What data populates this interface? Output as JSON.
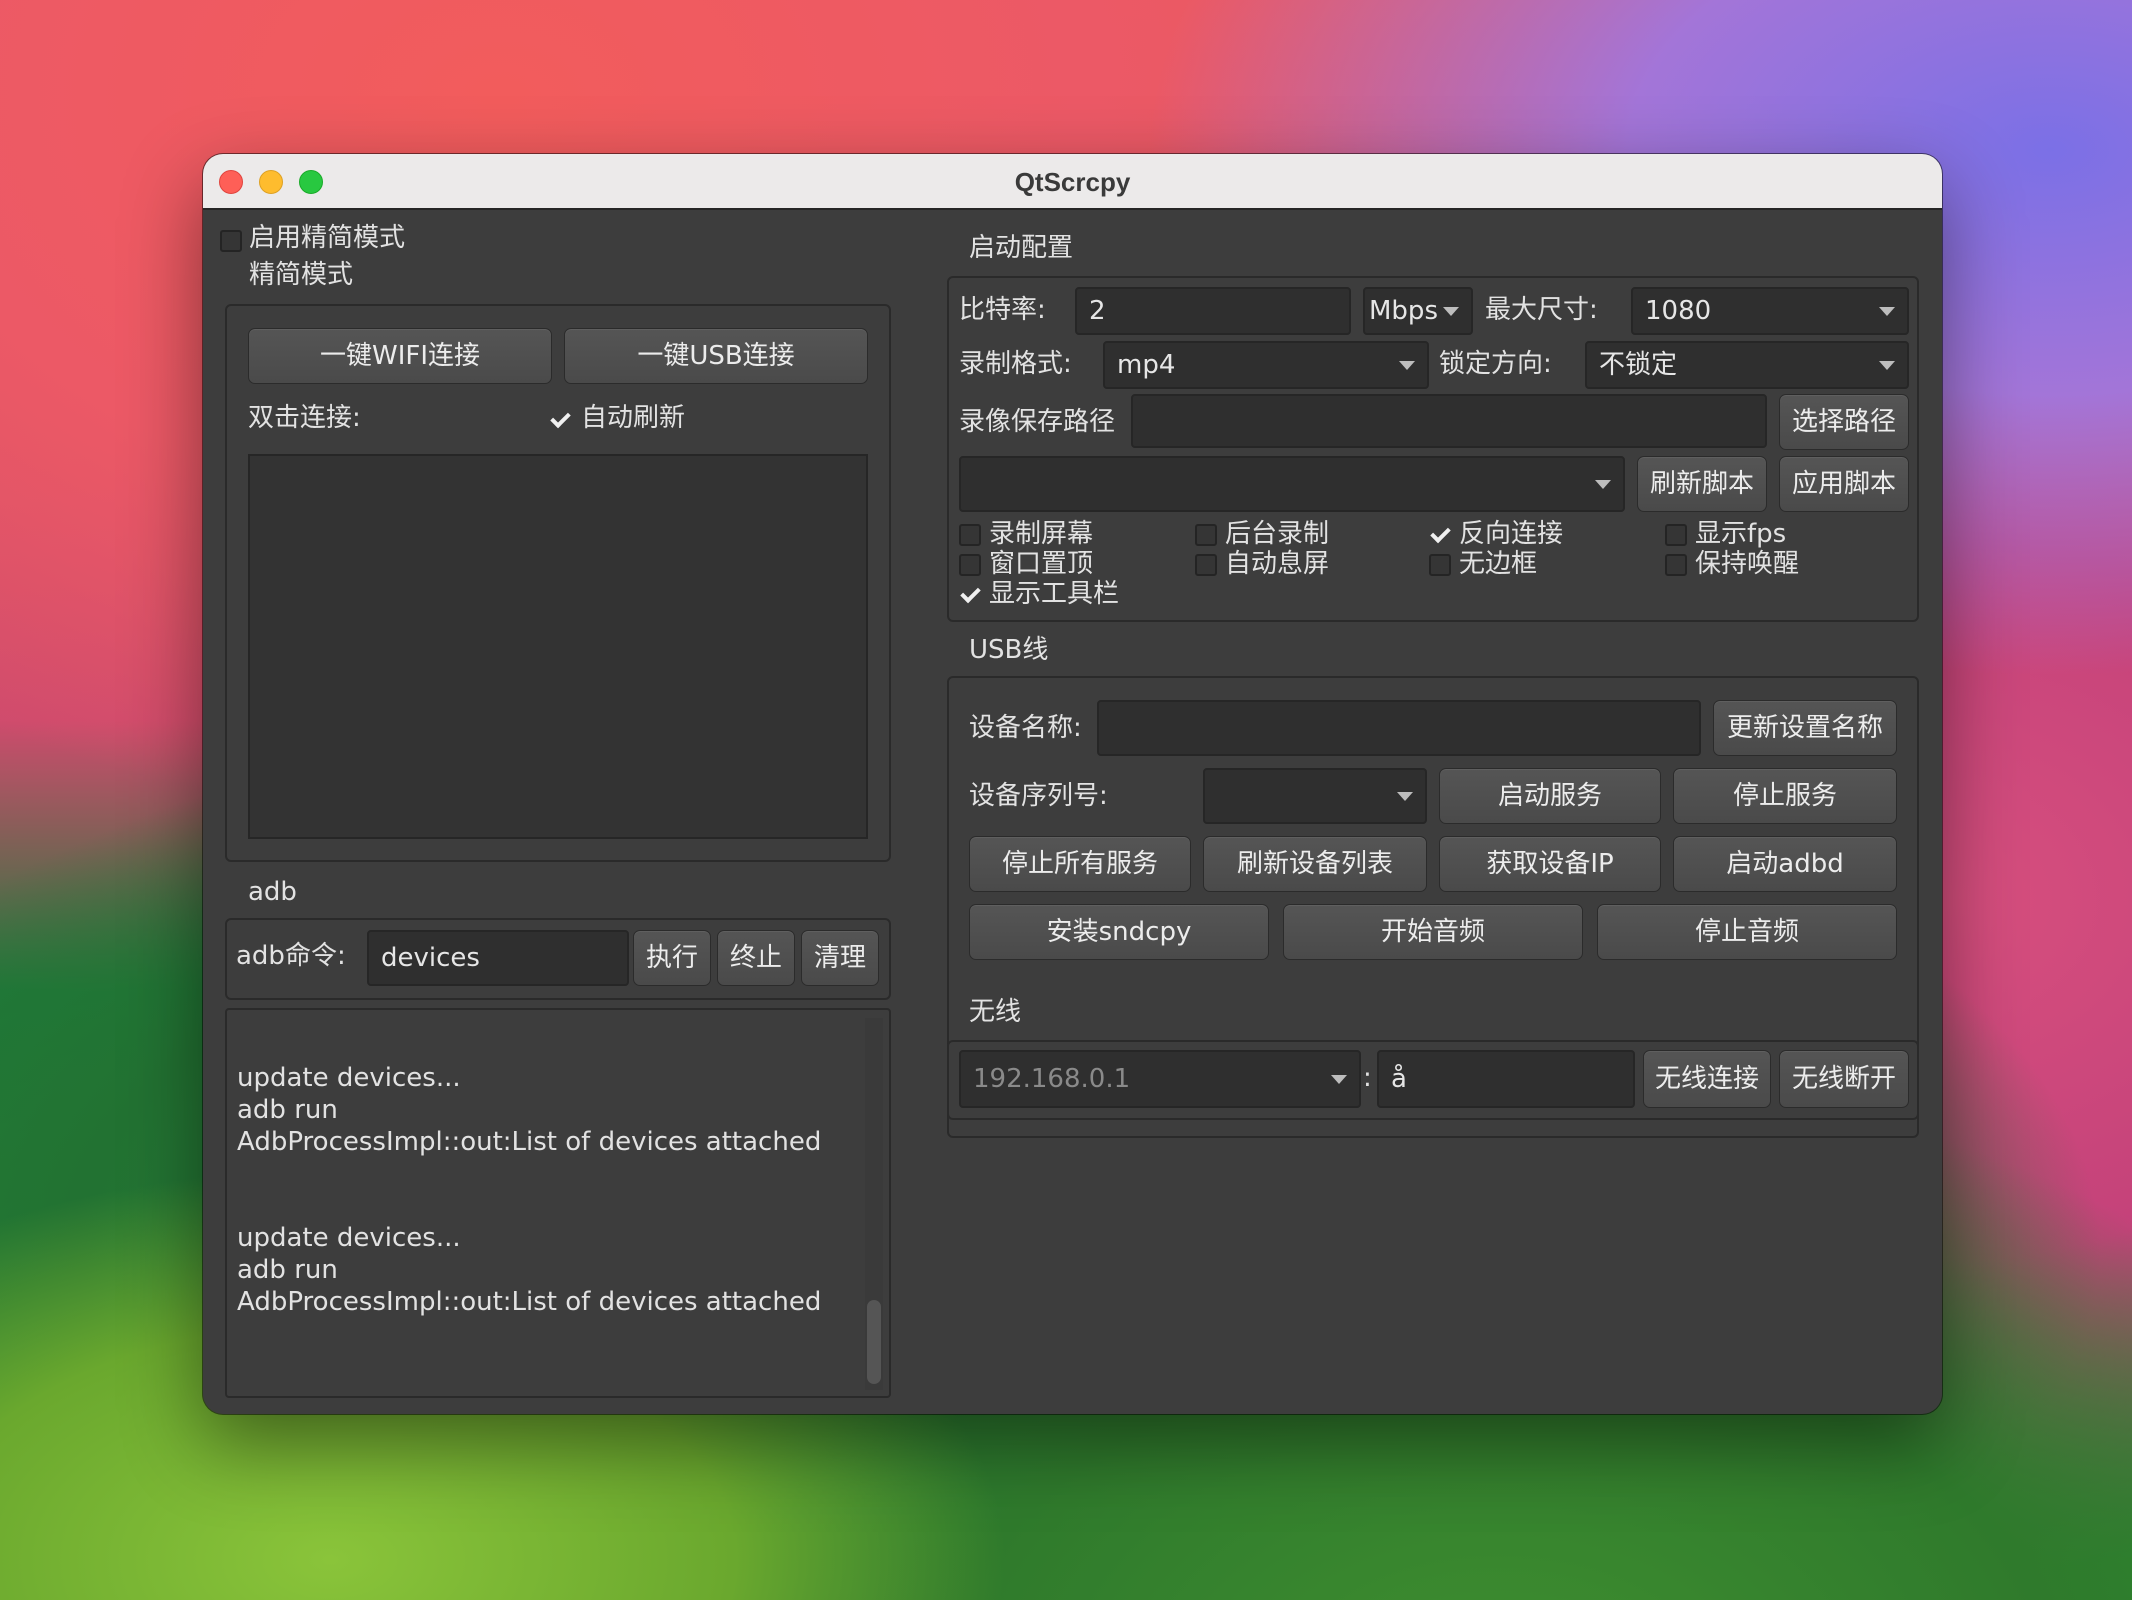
{
  "window": {
    "title": "QtScrcpy"
  },
  "left": {
    "simple_mode_checkbox": "启用精简模式",
    "simple_mode_group": "精简模式",
    "wifi_button": "一键WIFI连接",
    "usb_button": "一键USB连接",
    "double_click_label": "双击连接:",
    "auto_refresh": "自动刷新",
    "adb_group": "adb",
    "adb_cmd_label": "adb命令:",
    "adb_cmd_value": "devices",
    "exec_button": "执行",
    "stop_button": "终止",
    "clear_button": "清理",
    "log_lines": [
      "update devices...",
      "adb run",
      "AdbProcessImpl::out:List of devices attached",
      "update devices...",
      "adb run",
      "AdbProcessImpl::out:List of devices attached"
    ]
  },
  "start_config": {
    "group": "启动配置",
    "bitrate_label": "比特率:",
    "bitrate_value": "2",
    "bitrate_unit": "Mbps",
    "max_size_label": "最大尺寸:",
    "max_size_value": "1080",
    "record_format_label": "录制格式:",
    "record_format_value": "mp4",
    "lock_orientation_label": "锁定方向:",
    "lock_orientation_value": "不锁定",
    "record_path_label": "录像保存路径",
    "record_path_value": "",
    "select_path_button": "选择路径",
    "refresh_script_button": "刷新脚本",
    "apply_script_button": "应用脚本",
    "options": [
      {
        "label": "录制屏幕",
        "checked": false
      },
      {
        "label": "后台录制",
        "checked": false
      },
      {
        "label": "反向连接",
        "checked": true
      },
      {
        "label": "显示fps",
        "checked": false
      },
      {
        "label": "窗口置顶",
        "checked": false
      },
      {
        "label": "自动息屏",
        "checked": false
      },
      {
        "label": "无边框",
        "checked": false
      },
      {
        "label": "保持唤醒",
        "checked": false
      },
      {
        "label": "显示工具栏",
        "checked": true
      }
    ]
  },
  "usb": {
    "group": "USB线",
    "device_name_label": "设备名称:",
    "device_name_value": "",
    "update_name_button": "更新设置名称",
    "serial_label": "设备序列号:",
    "start_service_button": "启动服务",
    "stop_service_button": "停止服务",
    "stop_all_button": "停止所有服务",
    "refresh_devices_button": "刷新设备列表",
    "get_ip_button": "获取设备IP",
    "start_adbd_button": "启动adbd",
    "install_sndcpy_button": "安装sndcpy",
    "start_audio_button": "开始音频",
    "stop_audio_button": "停止音频"
  },
  "wireless": {
    "group": "无线",
    "ip_placeholder": "192.168.0.1",
    "colon": ":",
    "port_value": "å",
    "connect_button": "无线连接",
    "disconnect_button": "无线断开"
  },
  "colors": {
    "window_bg": "#3d3d3d",
    "field_bg": "#2f2f2f",
    "button_bg": "#4e4e4e",
    "close": "#fe5f57",
    "minimize": "#febc2e",
    "maximize": "#28c840"
  }
}
